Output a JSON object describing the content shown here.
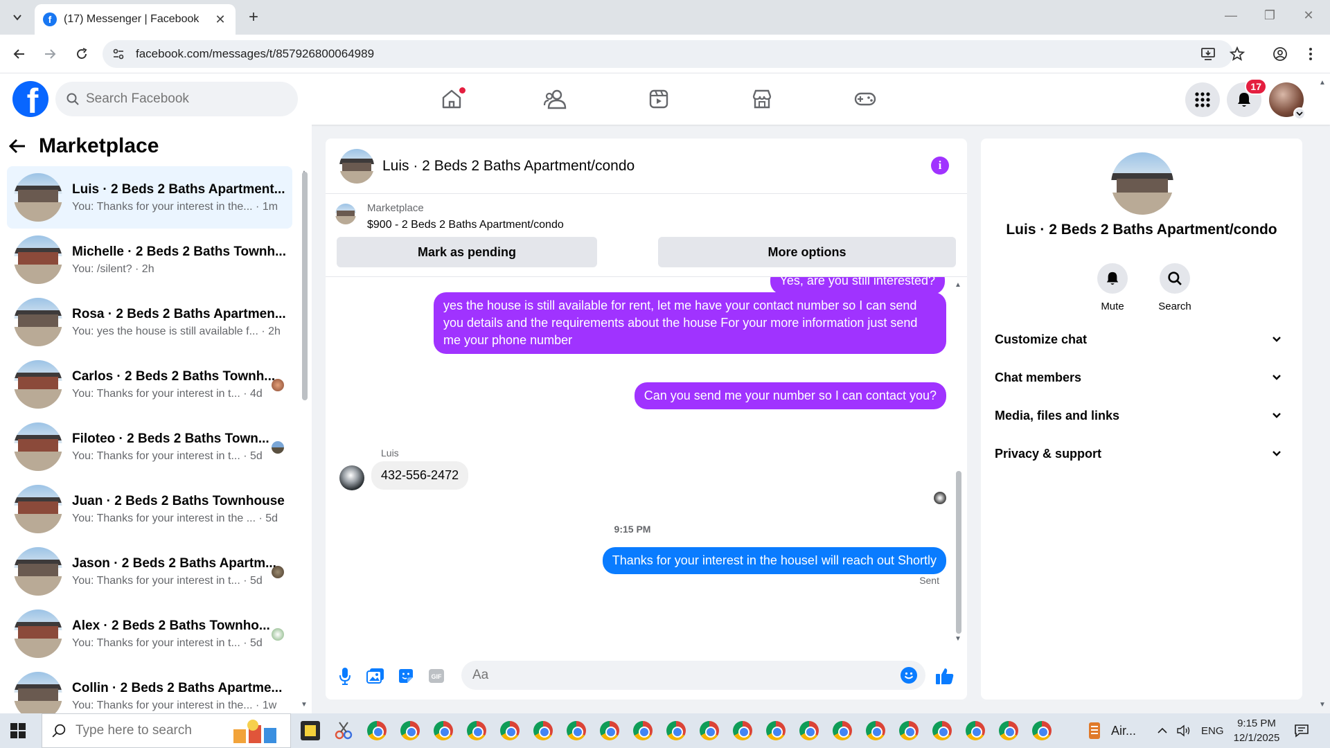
{
  "browser": {
    "tab_title": "(17) Messenger | Facebook",
    "url": "facebook.com/messages/t/857926800064989"
  },
  "fbnav": {
    "search_placeholder": "Search Facebook",
    "notifications_count": "17"
  },
  "sidebar": {
    "title": "Marketplace",
    "conversations": [
      {
        "name": "Luis · 2 Beds 2 Baths Apartment...",
        "preview": "You: Thanks for your interest in the... · 1m",
        "active": true
      },
      {
        "name": "Michelle · 2 Beds 2 Baths Townh...",
        "preview": "You: /silent? · 2h"
      },
      {
        "name": "Rosa · 2 Beds 2 Baths Apartmen...",
        "preview": "You: yes the house is still available f... · 2h"
      },
      {
        "name": "Carlos · 2 Beds 2 Baths Townh...",
        "preview": "You: Thanks for your interest in t... · 4d"
      },
      {
        "name": "Filoteo · 2 Beds 2 Baths Town...",
        "preview": "You: Thanks for your interest in t... · 5d"
      },
      {
        "name": "Juan · 2 Beds 2 Baths Townhouse",
        "preview": "You: Thanks for your interest in the ... · 5d"
      },
      {
        "name": "Jason · 2 Beds 2 Baths Apartm...",
        "preview": "You: Thanks for your interest in t... · 5d"
      },
      {
        "name": "Alex · 2 Beds 2 Baths Townho...",
        "preview": "You: Thanks for your interest in t... · 5d"
      },
      {
        "name": "Collin · 2 Beds 2 Baths Apartme...",
        "preview": "You: Thanks for your interest in the... · 1w"
      }
    ]
  },
  "chat": {
    "title": "Luis · 2 Beds 2 Baths Apartment/condo",
    "marketplace_label": "Marketplace",
    "listing": "$900 - 2 Beds 2 Baths Apartment/condo",
    "mark_pending": "Mark as pending",
    "more_options": "More options",
    "messages": {
      "cut_off": "Yes, are you still interested?",
      "long_reply": "yes the house is still available for rent, let me have your contact number so I can send you details and the requirements about the house For  your  more  information  just send  me   your  phone  number",
      "ask_number": "Can you send me your number so I can contact you?",
      "sender_name": "Luis",
      "phone": "432-556-2472",
      "timestamp": "9:15 PM",
      "last": "Thanks for your interest in the houseI will reach out Shortly",
      "status": "Sent"
    },
    "composer_placeholder": "Aa"
  },
  "details": {
    "title": "Luis · 2 Beds 2 Baths Apartment/condo",
    "mute": "Mute",
    "search": "Search",
    "sections": [
      "Customize chat",
      "Chat members",
      "Media, files and links",
      "Privacy & support"
    ]
  },
  "taskbar": {
    "search_placeholder": "Type here to search",
    "weather": "Air...",
    "lang": "ENG",
    "time": "9:15 PM",
    "date": "12/1/2025"
  },
  "colors": {
    "fb_blue": "#0866ff",
    "purple_bubble": "#a033ff",
    "blue_bubble": "#0a7cff"
  }
}
